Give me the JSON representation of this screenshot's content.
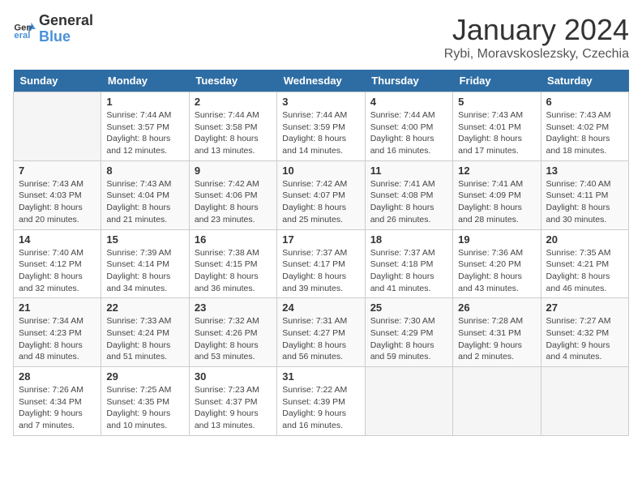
{
  "header": {
    "logo_line1": "General",
    "logo_line2": "Blue",
    "title": "January 2024",
    "subtitle": "Rybi, Moravskoslezsky, Czechia"
  },
  "weekdays": [
    "Sunday",
    "Monday",
    "Tuesday",
    "Wednesday",
    "Thursday",
    "Friday",
    "Saturday"
  ],
  "weeks": [
    [
      {
        "day": "",
        "info": ""
      },
      {
        "day": "1",
        "info": "Sunrise: 7:44 AM\nSunset: 3:57 PM\nDaylight: 8 hours\nand 12 minutes."
      },
      {
        "day": "2",
        "info": "Sunrise: 7:44 AM\nSunset: 3:58 PM\nDaylight: 8 hours\nand 13 minutes."
      },
      {
        "day": "3",
        "info": "Sunrise: 7:44 AM\nSunset: 3:59 PM\nDaylight: 8 hours\nand 14 minutes."
      },
      {
        "day": "4",
        "info": "Sunrise: 7:44 AM\nSunset: 4:00 PM\nDaylight: 8 hours\nand 16 minutes."
      },
      {
        "day": "5",
        "info": "Sunrise: 7:43 AM\nSunset: 4:01 PM\nDaylight: 8 hours\nand 17 minutes."
      },
      {
        "day": "6",
        "info": "Sunrise: 7:43 AM\nSunset: 4:02 PM\nDaylight: 8 hours\nand 18 minutes."
      }
    ],
    [
      {
        "day": "7",
        "info": "Sunrise: 7:43 AM\nSunset: 4:03 PM\nDaylight: 8 hours\nand 20 minutes."
      },
      {
        "day": "8",
        "info": "Sunrise: 7:43 AM\nSunset: 4:04 PM\nDaylight: 8 hours\nand 21 minutes."
      },
      {
        "day": "9",
        "info": "Sunrise: 7:42 AM\nSunset: 4:06 PM\nDaylight: 8 hours\nand 23 minutes."
      },
      {
        "day": "10",
        "info": "Sunrise: 7:42 AM\nSunset: 4:07 PM\nDaylight: 8 hours\nand 25 minutes."
      },
      {
        "day": "11",
        "info": "Sunrise: 7:41 AM\nSunset: 4:08 PM\nDaylight: 8 hours\nand 26 minutes."
      },
      {
        "day": "12",
        "info": "Sunrise: 7:41 AM\nSunset: 4:09 PM\nDaylight: 8 hours\nand 28 minutes."
      },
      {
        "day": "13",
        "info": "Sunrise: 7:40 AM\nSunset: 4:11 PM\nDaylight: 8 hours\nand 30 minutes."
      }
    ],
    [
      {
        "day": "14",
        "info": "Sunrise: 7:40 AM\nSunset: 4:12 PM\nDaylight: 8 hours\nand 32 minutes."
      },
      {
        "day": "15",
        "info": "Sunrise: 7:39 AM\nSunset: 4:14 PM\nDaylight: 8 hours\nand 34 minutes."
      },
      {
        "day": "16",
        "info": "Sunrise: 7:38 AM\nSunset: 4:15 PM\nDaylight: 8 hours\nand 36 minutes."
      },
      {
        "day": "17",
        "info": "Sunrise: 7:37 AM\nSunset: 4:17 PM\nDaylight: 8 hours\nand 39 minutes."
      },
      {
        "day": "18",
        "info": "Sunrise: 7:37 AM\nSunset: 4:18 PM\nDaylight: 8 hours\nand 41 minutes."
      },
      {
        "day": "19",
        "info": "Sunrise: 7:36 AM\nSunset: 4:20 PM\nDaylight: 8 hours\nand 43 minutes."
      },
      {
        "day": "20",
        "info": "Sunrise: 7:35 AM\nSunset: 4:21 PM\nDaylight: 8 hours\nand 46 minutes."
      }
    ],
    [
      {
        "day": "21",
        "info": "Sunrise: 7:34 AM\nSunset: 4:23 PM\nDaylight: 8 hours\nand 48 minutes."
      },
      {
        "day": "22",
        "info": "Sunrise: 7:33 AM\nSunset: 4:24 PM\nDaylight: 8 hours\nand 51 minutes."
      },
      {
        "day": "23",
        "info": "Sunrise: 7:32 AM\nSunset: 4:26 PM\nDaylight: 8 hours\nand 53 minutes."
      },
      {
        "day": "24",
        "info": "Sunrise: 7:31 AM\nSunset: 4:27 PM\nDaylight: 8 hours\nand 56 minutes."
      },
      {
        "day": "25",
        "info": "Sunrise: 7:30 AM\nSunset: 4:29 PM\nDaylight: 8 hours\nand 59 minutes."
      },
      {
        "day": "26",
        "info": "Sunrise: 7:28 AM\nSunset: 4:31 PM\nDaylight: 9 hours\nand 2 minutes."
      },
      {
        "day": "27",
        "info": "Sunrise: 7:27 AM\nSunset: 4:32 PM\nDaylight: 9 hours\nand 4 minutes."
      }
    ],
    [
      {
        "day": "28",
        "info": "Sunrise: 7:26 AM\nSunset: 4:34 PM\nDaylight: 9 hours\nand 7 minutes."
      },
      {
        "day": "29",
        "info": "Sunrise: 7:25 AM\nSunset: 4:35 PM\nDaylight: 9 hours\nand 10 minutes."
      },
      {
        "day": "30",
        "info": "Sunrise: 7:23 AM\nSunset: 4:37 PM\nDaylight: 9 hours\nand 13 minutes."
      },
      {
        "day": "31",
        "info": "Sunrise: 7:22 AM\nSunset: 4:39 PM\nDaylight: 9 hours\nand 16 minutes."
      },
      {
        "day": "",
        "info": ""
      },
      {
        "day": "",
        "info": ""
      },
      {
        "day": "",
        "info": ""
      }
    ]
  ]
}
